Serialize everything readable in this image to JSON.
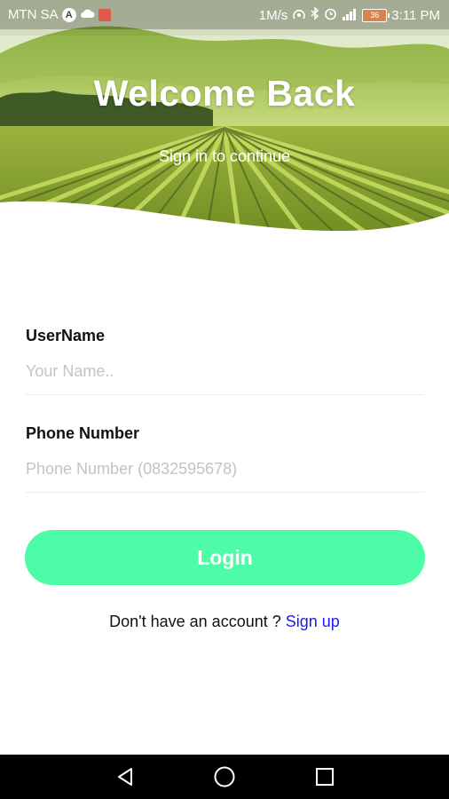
{
  "status_bar": {
    "carrier": "MTN SA",
    "network_speed": "1M/s",
    "battery_level": "36",
    "time": "3:11 PM",
    "icons": [
      "a-badge-icon",
      "cloud-icon",
      "notification-icon",
      "hotspot-icon",
      "bluetooth-icon",
      "alarm-icon",
      "signal-icon",
      "battery-icon"
    ]
  },
  "header": {
    "title": "Welcome Back",
    "subtitle": "Sign in to continue"
  },
  "form": {
    "username": {
      "label": "UserName",
      "placeholder": "Your Name..",
      "value": ""
    },
    "phone": {
      "label": "Phone Number",
      "placeholder": "Phone Number (0832595678)",
      "value": ""
    },
    "login_label": "Login",
    "signup_prompt": "Don't have an account ?",
    "signup_link": "Sign up"
  },
  "nav_bar": {
    "buttons": [
      "back-icon",
      "home-icon",
      "recents-icon"
    ]
  },
  "colors": {
    "accent": "#4dfca6",
    "link": "#1a1aff",
    "placeholder": "#c3c3c3"
  }
}
